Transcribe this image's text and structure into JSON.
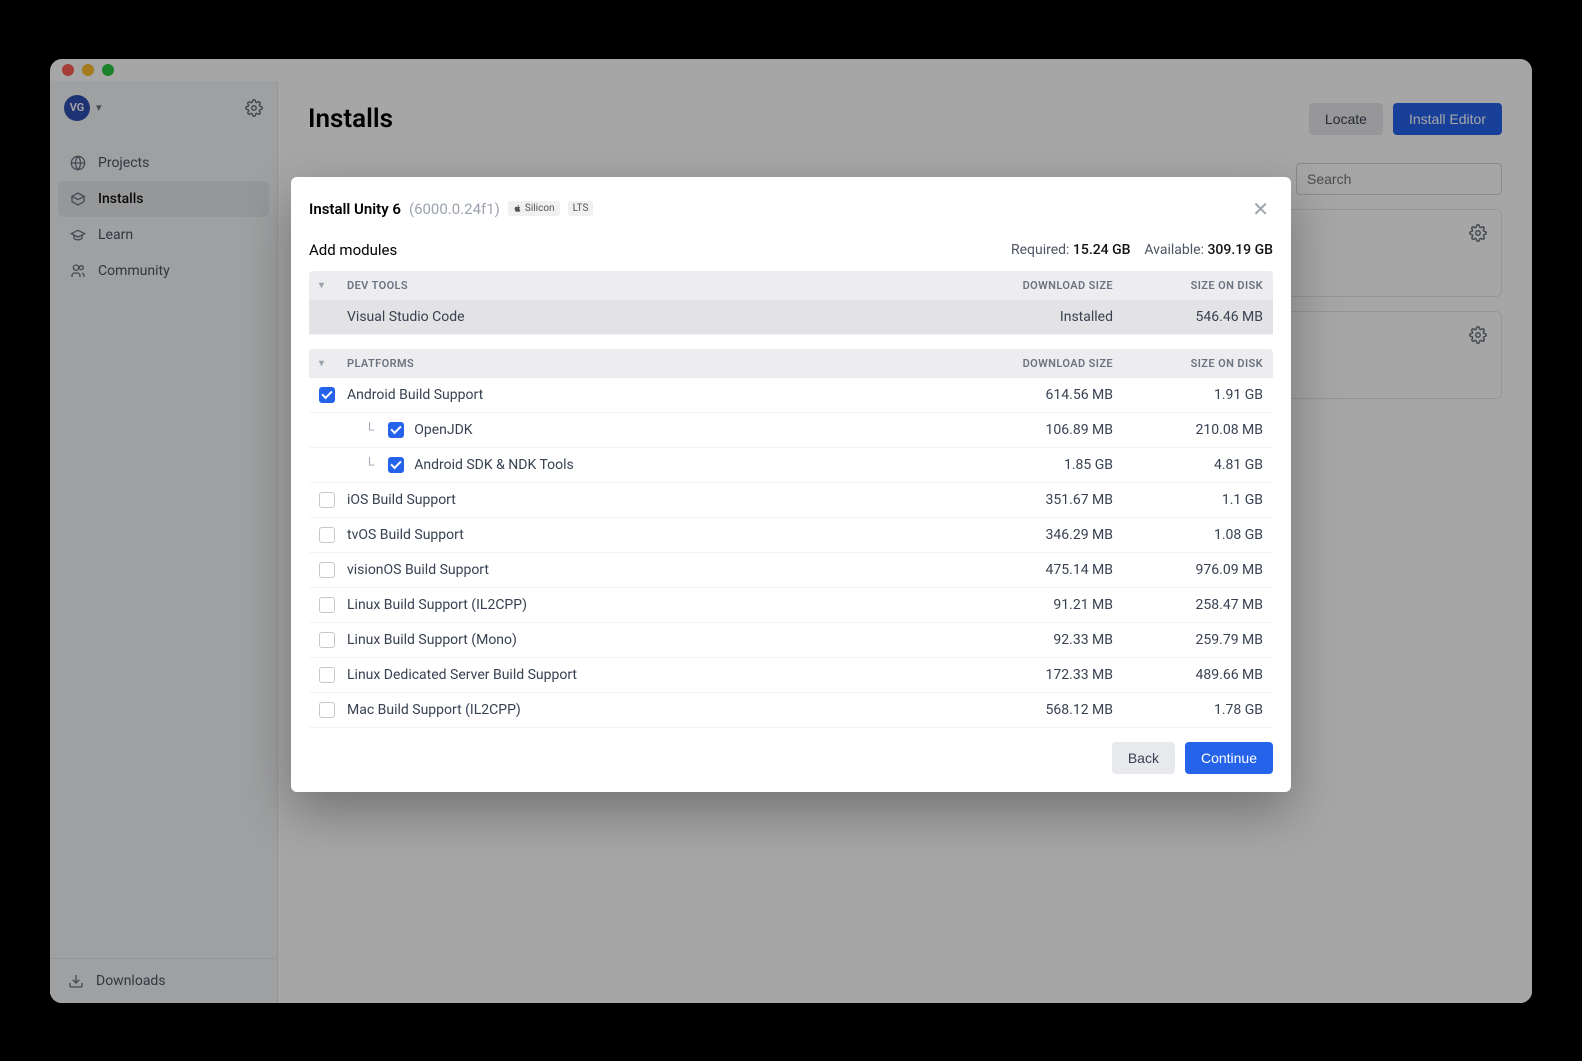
{
  "user": {
    "initials": "VG"
  },
  "sidebar": {
    "items": [
      {
        "label": "Projects",
        "icon": "globe"
      },
      {
        "label": "Installs",
        "icon": "package",
        "active": true
      },
      {
        "label": "Learn",
        "icon": "cap"
      },
      {
        "label": "Community",
        "icon": "people"
      }
    ],
    "downloads_label": "Downloads"
  },
  "main": {
    "title": "Installs",
    "locate_label": "Locate",
    "install_editor_label": "Install Editor",
    "search_placeholder": "Search"
  },
  "modal": {
    "title_prefix": "Install Unity 6",
    "version": "(6000.0.24f1)",
    "badge_silicon": "Silicon",
    "badge_lts": "LTS",
    "subtitle": "Add modules",
    "required_label": "Required:",
    "required_value": "15.24 GB",
    "available_label": "Available:",
    "available_value": "309.19 GB",
    "sections": {
      "devtools": {
        "header": "DEV TOOLS",
        "col_download": "DOWNLOAD SIZE",
        "col_disk": "SIZE ON DISK",
        "rows": [
          {
            "name": "Visual Studio Code",
            "download": "Installed",
            "disk": "546.46 MB",
            "installed": true
          }
        ]
      },
      "platforms": {
        "header": "PLATFORMS",
        "col_download": "DOWNLOAD SIZE",
        "col_disk": "SIZE ON DISK",
        "rows": [
          {
            "name": "Android Build Support",
            "download": "614.56 MB",
            "disk": "1.91 GB",
            "checked": true
          },
          {
            "name": "OpenJDK",
            "download": "106.89 MB",
            "disk": "210.08 MB",
            "checked": true,
            "child": true
          },
          {
            "name": "Android SDK & NDK Tools",
            "download": "1.85 GB",
            "disk": "4.81 GB",
            "checked": true,
            "child": true
          },
          {
            "name": "iOS Build Support",
            "download": "351.67 MB",
            "disk": "1.1 GB",
            "checked": false
          },
          {
            "name": "tvOS Build Support",
            "download": "346.29 MB",
            "disk": "1.08 GB",
            "checked": false
          },
          {
            "name": "visionOS Build Support",
            "download": "475.14 MB",
            "disk": "976.09 MB",
            "checked": false
          },
          {
            "name": "Linux Build Support (IL2CPP)",
            "download": "91.21 MB",
            "disk": "258.47 MB",
            "checked": false
          },
          {
            "name": "Linux Build Support (Mono)",
            "download": "92.33 MB",
            "disk": "259.79 MB",
            "checked": false
          },
          {
            "name": "Linux Dedicated Server Build Support",
            "download": "172.33 MB",
            "disk": "489.66 MB",
            "checked": false
          },
          {
            "name": "Mac Build Support (IL2CPP)",
            "download": "568.12 MB",
            "disk": "1.78 GB",
            "checked": false
          }
        ]
      }
    },
    "back_label": "Back",
    "continue_label": "Continue"
  }
}
